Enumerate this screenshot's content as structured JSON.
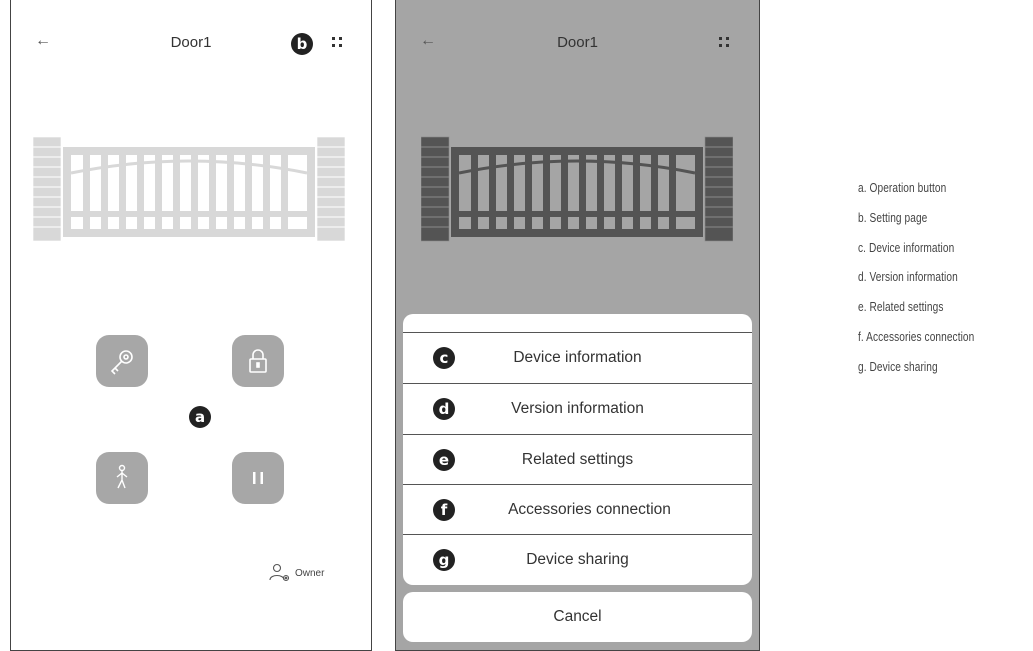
{
  "screen1": {
    "back_icon": "←",
    "title": "Door1",
    "badge_b": "b",
    "badge_a": "a",
    "buttons": [
      "key-icon",
      "lock-icon",
      "pedestrian-icon",
      "pause-icon"
    ],
    "owner_label": "Owner"
  },
  "screen2": {
    "back_icon": "←",
    "title": "Door1",
    "sheet_items": [
      {
        "badge": "c",
        "label": "Device information"
      },
      {
        "badge": "d",
        "label": "Version information"
      },
      {
        "badge": "e",
        "label": "Related settings"
      },
      {
        "badge": "f",
        "label": "Accessories connection"
      },
      {
        "badge": "g",
        "label": "Device sharing"
      }
    ],
    "cancel_label": "Cancel"
  },
  "legend": [
    "a. Operation button",
    "b. Setting page",
    "c. Device information",
    "d. Version information",
    "e. Related settings",
    "f.  Accessories connection",
    "g. Device sharing"
  ],
  "colors": {
    "button_gray": "#a7a7a7",
    "overlay_gray": "#a5a5a5",
    "gate_light": "#d8d8d8",
    "gate_dark": "#545454",
    "badge": "#222222"
  }
}
